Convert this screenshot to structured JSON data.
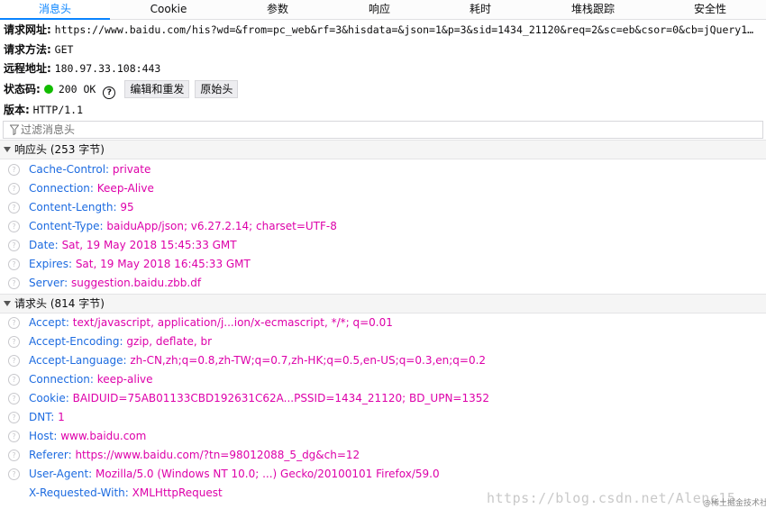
{
  "tabs": [
    {
      "label": "消息头",
      "active": true
    },
    {
      "label": "Cookie",
      "active": false
    },
    {
      "label": "参数",
      "active": false
    },
    {
      "label": "响应",
      "active": false
    },
    {
      "label": "耗时",
      "active": false
    },
    {
      "label": "堆栈跟踪",
      "active": false
    },
    {
      "label": "安全性",
      "active": false
    }
  ],
  "summary": {
    "url_label": "请求网址:",
    "url_value": "https://www.baidu.com/his?wd=&from=pc_web&rf=3&hisdata=&json=1&p=3&sid=1434_21120&req=2&sc=eb&csor=0&cb=jQuery1…",
    "method_label": "请求方法:",
    "method_value": "GET",
    "remote_label": "远程地址:",
    "remote_value": "180.97.33.108:443",
    "status_label": "状态码:",
    "status_value": "200 OK",
    "status_color": "#12bc00",
    "edit_resend_label": "编辑和重发",
    "raw_headers_label": "原始头",
    "version_label": "版本:",
    "version_value": "HTTP/1.1"
  },
  "filter": {
    "placeholder": "过滤消息头"
  },
  "response_headers": {
    "title": "响应头 (253 字节)",
    "items": [
      {
        "name": "Cache-Control:",
        "value": "private"
      },
      {
        "name": "Connection:",
        "value": "Keep-Alive"
      },
      {
        "name": "Content-Length:",
        "value": "95"
      },
      {
        "name": "Content-Type:",
        "value": "baiduApp/json; v6.27.2.14; charset=UTF-8"
      },
      {
        "name": "Date:",
        "value": "Sat, 19 May 2018 15:45:33 GMT"
      },
      {
        "name": "Expires:",
        "value": "Sat, 19 May 2018 16:45:33 GMT"
      },
      {
        "name": "Server:",
        "value": "suggestion.baidu.zbb.df"
      }
    ]
  },
  "request_headers": {
    "title": "请求头 (814 字节)",
    "items": [
      {
        "name": "Accept:",
        "value": "text/javascript, application/j...ion/x-ecmascript, */*; q=0.01"
      },
      {
        "name": "Accept-Encoding:",
        "value": "gzip, deflate, br"
      },
      {
        "name": "Accept-Language:",
        "value": "zh-CN,zh;q=0.8,zh-TW;q=0.7,zh-HK;q=0.5,en-US;q=0.3,en;q=0.2"
      },
      {
        "name": "Connection:",
        "value": "keep-alive"
      },
      {
        "name": "Cookie:",
        "value": "BAIDUID=75AB01133CBD192631C62A...PSSID=1434_21120; BD_UPN=1352"
      },
      {
        "name": "DNT:",
        "value": "1"
      },
      {
        "name": "Host:",
        "value": "www.baidu.com"
      },
      {
        "name": "Referer:",
        "value": "https://www.baidu.com/?tn=98012088_5_dg&ch=12"
      },
      {
        "name": "User-Agent:",
        "value": "Mozilla/5.0 (Windows NT 10.0; ...) Gecko/20100101 Firefox/59.0"
      },
      {
        "name": "X-Requested-With:",
        "value": "XMLHttpRequest"
      }
    ]
  },
  "watermark": {
    "text": "https://blog.csdn.net/Alenc15",
    "badge": "@稀土掘金技术社区"
  },
  "colors": {
    "accent": "#0a84ff",
    "header_name": "#1d6be0",
    "header_value": "#dd00a9"
  },
  "icons": {
    "help": "question-circle-icon",
    "filter": "funnel-icon",
    "row_help": "question-circle-icon",
    "twisty": "triangle-down-icon"
  }
}
